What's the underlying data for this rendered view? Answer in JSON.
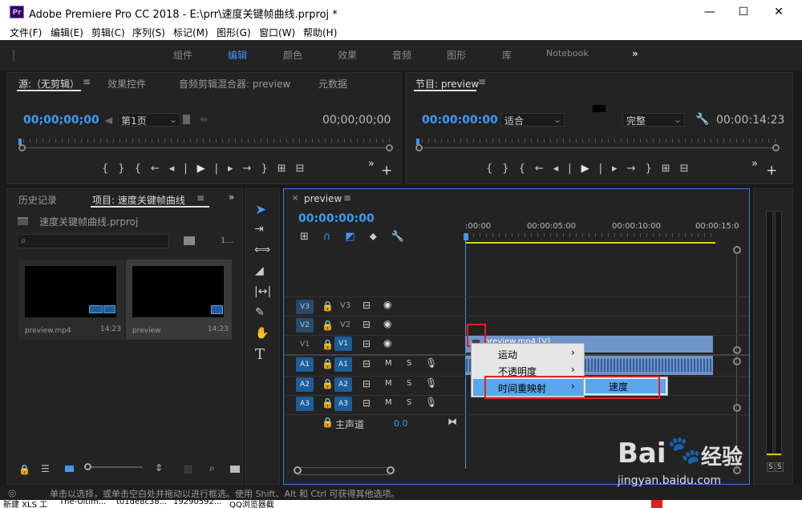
{
  "title_bar": {
    "app_icon": "Pr",
    "title": "Adobe Premiere Pro CC 2018 - E:\\prr\\速度关键帧曲线.prproj *",
    "minimize": "—",
    "maximize": "☐",
    "close": "✕"
  },
  "menu": [
    "文件(F)",
    "编辑(E)",
    "剪辑(C)",
    "序列(S)",
    "标记(M)",
    "图形(G)",
    "窗口(W)",
    "帮助(H)"
  ],
  "workspaces": {
    "items": [
      "组件",
      "编辑",
      "颜色",
      "效果",
      "音频",
      "图形",
      "库",
      "Notebook"
    ],
    "active": "编辑",
    "more": "»"
  },
  "source_panel": {
    "tabs": [
      "源:（无剪辑）",
      "效果控件",
      "音频剪辑混合器: preview",
      "元数据"
    ],
    "timecode_left": "00;00;00;00",
    "page_select": "第1页",
    "timecode_right": "00;00;00;00"
  },
  "program_panel": {
    "tab": "节目: preview",
    "timecode_left": "00:00:00:00",
    "fit_select": "适合",
    "quality_select": "完整",
    "timecode_right": "00:00:14:23"
  },
  "project_panel": {
    "tabs": [
      "历史记录",
      "项目: 速度关键帧曲线"
    ],
    "file": "速度关键帧曲线.prproj",
    "count": "1...",
    "items": [
      {
        "name": "preview.mp4",
        "duration": "14:23"
      },
      {
        "name": "preview",
        "duration": "14:23"
      }
    ]
  },
  "timeline": {
    "tab": "preview",
    "timecode": "00:00:00:00",
    "ruler": [
      ":00:00",
      "00:00:05:00",
      "00:00:10:00",
      "00:00:15:0"
    ],
    "video_tracks": [
      {
        "src": "V3",
        "tgt": "V3"
      },
      {
        "src": "V2",
        "tgt": "V2"
      },
      {
        "src": "V1",
        "tgt": "V1"
      }
    ],
    "audio_tracks": [
      {
        "src": "A1",
        "tgt": "A1"
      },
      {
        "src": "A2",
        "tgt": "A2"
      },
      {
        "src": "A3",
        "tgt": "A3"
      }
    ],
    "master_label": "主声道",
    "master_value": "0.0",
    "clip_label": "preview.mp4 [V]",
    "track_m": "M",
    "track_s": "S"
  },
  "context_menu": {
    "items": [
      "运动",
      "不透明度",
      "时间重映射"
    ],
    "submenu": "速度"
  },
  "meter": {
    "solo_labels": [
      "S",
      "S"
    ]
  },
  "status_bar": "单击以选择，或单击空白处并拖动以进行框选。使用 Shift、Alt 和 Ctrl 可获得其他选项。",
  "taskbar": [
    "新建 XLS 工",
    "The-Ultim...",
    "t01de8c38...",
    "19290592...",
    "QQ浏览器截"
  ],
  "watermark": {
    "brand": "Bai",
    "brand2": "经验",
    "url": "jingyan.baidu.com"
  },
  "colors": {
    "accent": "#3d9af5",
    "panel": "#232323",
    "bg": "#1a1a1a",
    "highlight": "#e02020",
    "clip": "#6f95c8"
  }
}
